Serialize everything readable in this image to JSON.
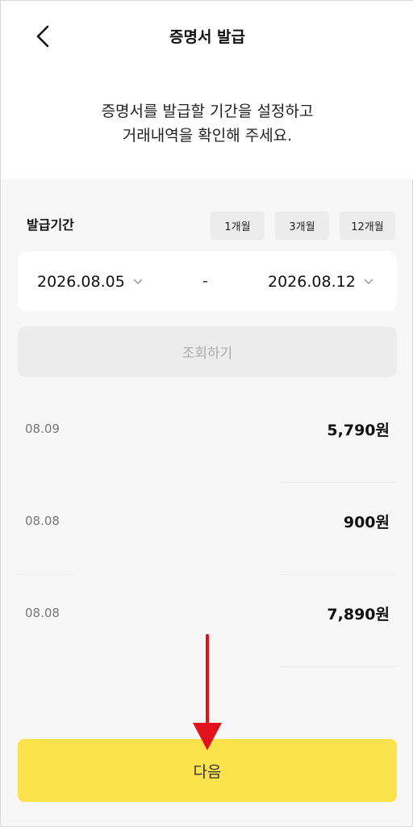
{
  "header": {
    "title": "증명서 발급",
    "back_icon": "chevron-left-icon"
  },
  "guide": {
    "line1": "증명서를 발급할 기간을 설정하고",
    "line2": "거래내역을 확인해 주세요."
  },
  "period": {
    "label": "발급기간",
    "quick_options": [
      "1개월",
      "3개월",
      "12개월"
    ],
    "start_date": "2026.08.05",
    "end_date": "2026.08.12",
    "separator": "-"
  },
  "query_button": "조회하기",
  "transactions": [
    {
      "date": "08.09",
      "amount": "5,790원"
    },
    {
      "date": "08.08",
      "amount": "900원"
    },
    {
      "date": "08.08",
      "amount": "7,890원"
    }
  ],
  "next_button": "다음",
  "colors": {
    "accent": "#fbe14b",
    "annotation_arrow": "#e0121b"
  }
}
